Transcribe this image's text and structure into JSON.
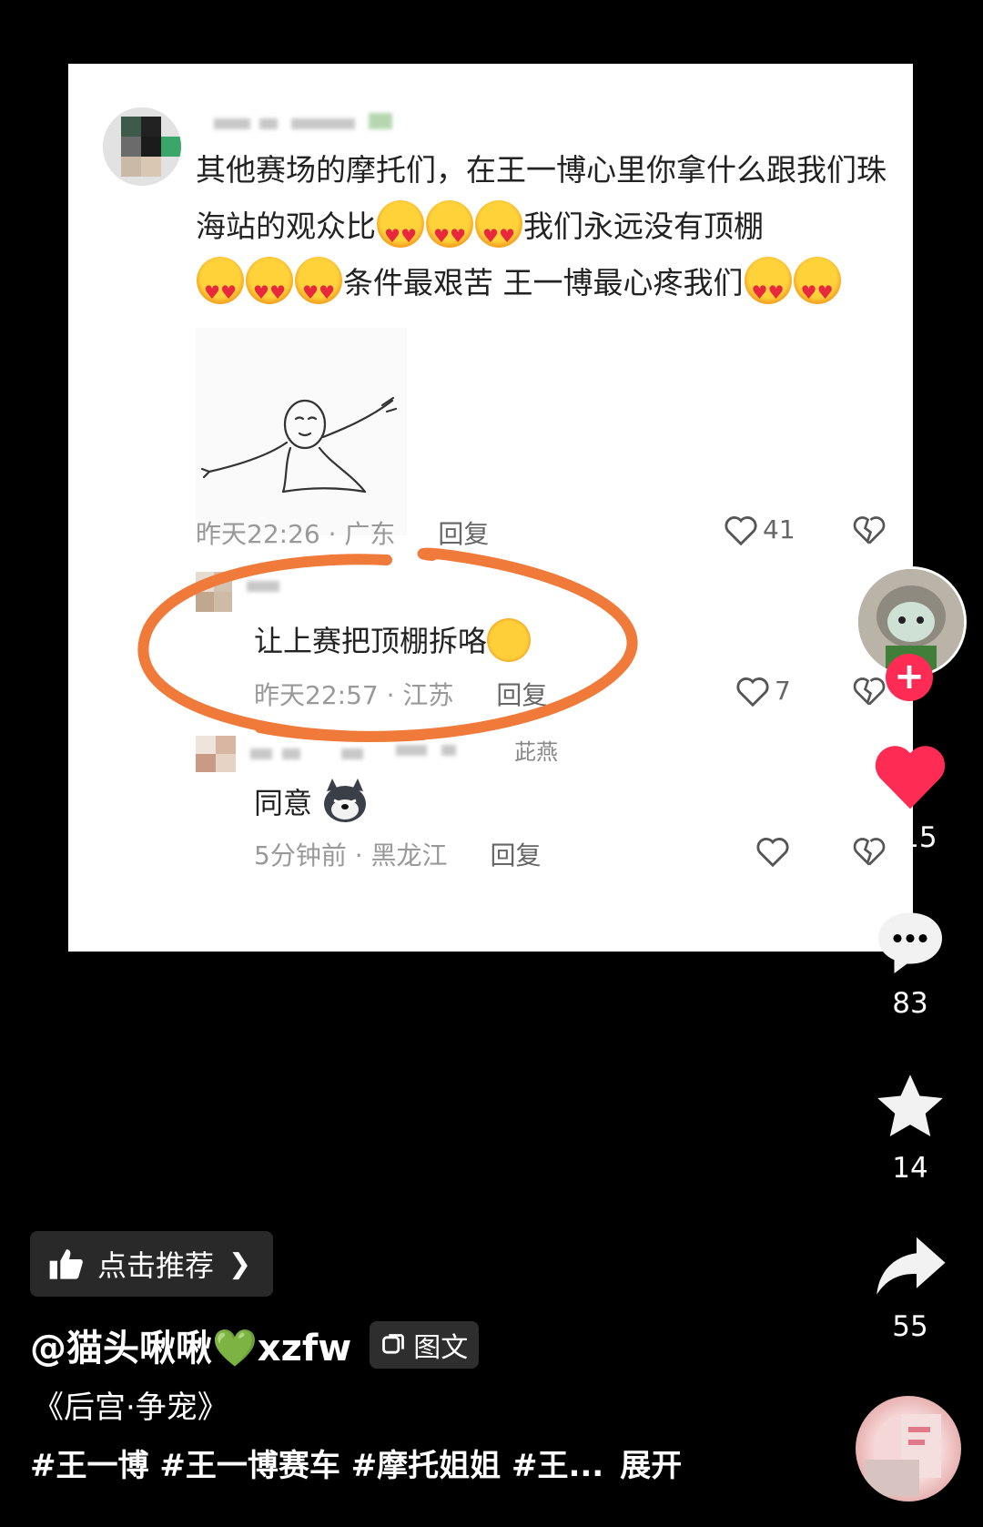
{
  "post_image": {
    "main_comment": {
      "text_part1": "其他赛场的摩托们，在王一博心里你拿什么跟我们珠海站的观众比",
      "text_part2": "我们永远没有顶棚",
      "text_part3": "条件最艰苦 王一博最心疼我们",
      "time": "昨天22:26",
      "location": "广东",
      "reply_label": "回复",
      "likes": "41"
    },
    "reply_1": {
      "text": "让上赛把顶棚拆咯",
      "time": "昨天22:57",
      "location": "江苏",
      "reply_label": "回复",
      "likes": "7"
    },
    "reply_2": {
      "username_tail": "茈燕",
      "text": "同意",
      "time": "5分钟前",
      "location": "黑龙江",
      "reply_label": "回复"
    },
    "annotation_color": "#f07a3a"
  },
  "sidebar": {
    "likes": "715",
    "comments": "83",
    "favorites": "14",
    "shares": "55",
    "like_color": "#fe2c55"
  },
  "bottom": {
    "recommend_label": "点击推荐",
    "author": "@猫头啾啾💚xzfw",
    "tag_label": "图文",
    "title": "《后宫·争宠》",
    "hashtags": "#王一博 #王一博赛车 #摩托姐姐 #王...",
    "expand": "展开"
  }
}
